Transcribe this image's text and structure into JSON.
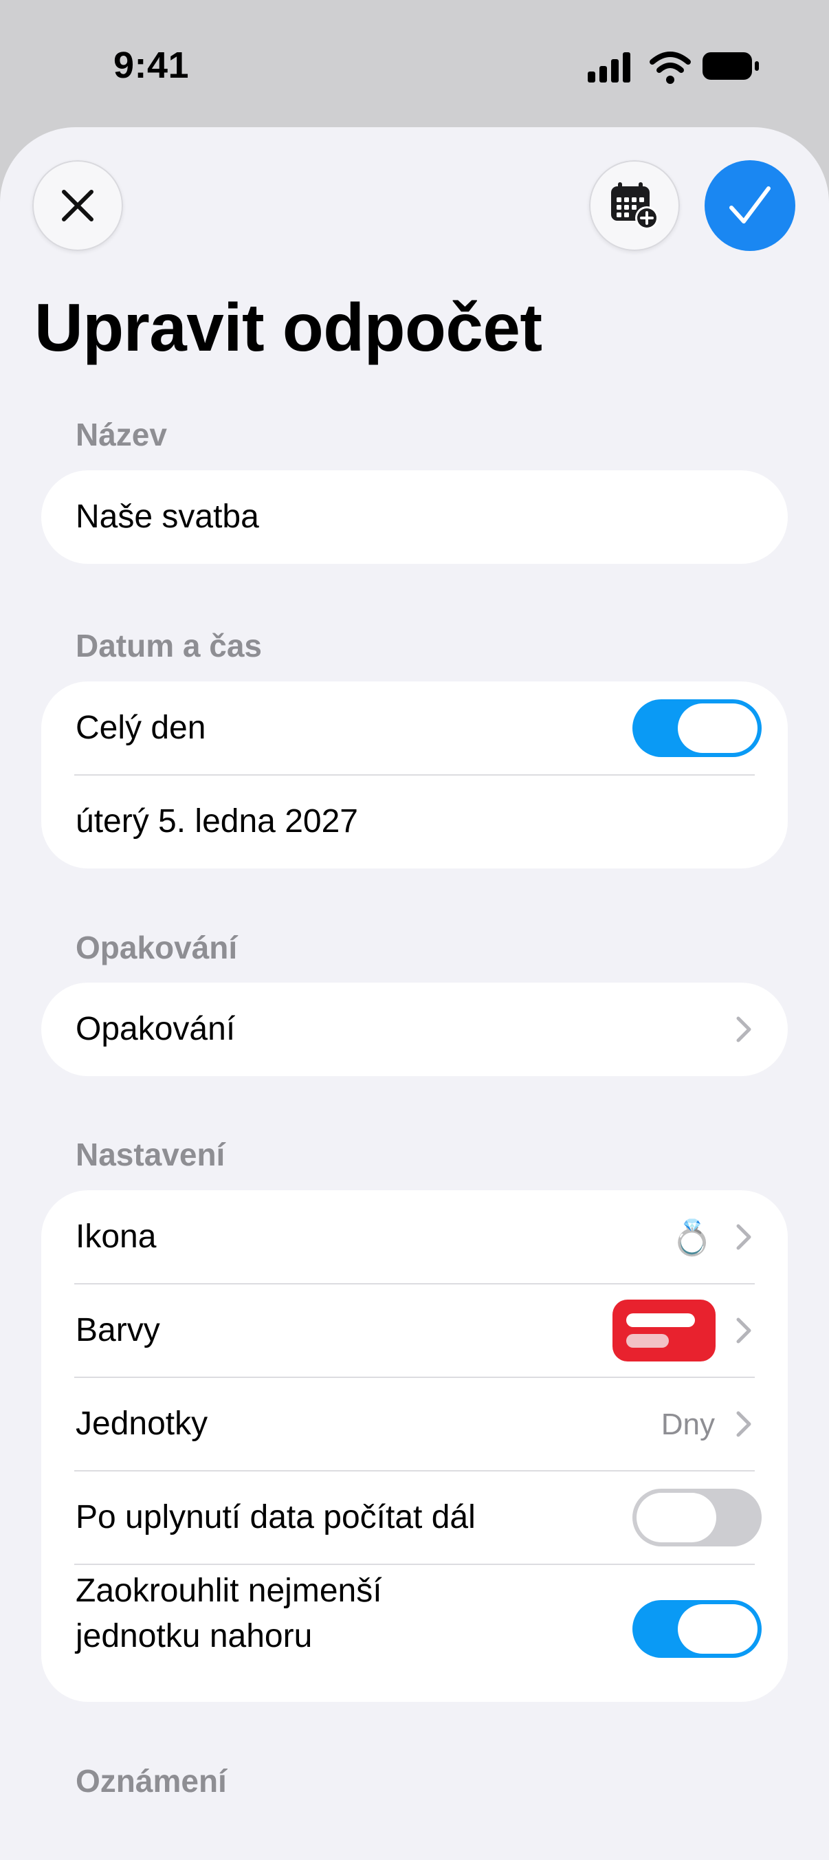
{
  "status": {
    "time": "9:41"
  },
  "header": {
    "title": "Upravit odpočet"
  },
  "colors": {
    "accent": "#1a87f2",
    "toggle_on": "#0a9af5",
    "chip": "#e8222e"
  },
  "sections": {
    "name": {
      "label": "Název",
      "value": "Naše svatba"
    },
    "datetime": {
      "label": "Datum a čas",
      "all_day_label": "Celý den",
      "all_day_on": true,
      "date": "úterý 5. ledna 2027"
    },
    "repeat": {
      "label": "Opakování",
      "row_label": "Opakování"
    },
    "settings": {
      "label": "Nastavení",
      "icon_label": "Ikona",
      "icon_value": "💍",
      "colors_label": "Barvy",
      "units_label": "Jednotky",
      "units_value": "Dny",
      "count_after_label": "Po uplynutí data počítat dál",
      "count_after_on": false,
      "round_up_line1": "Zaokrouhlit nejmenší",
      "round_up_line2": "jednotku nahoru",
      "round_up_on": true
    },
    "notifications": {
      "label": "Oznámení"
    }
  },
  "icons": [
    "close-icon",
    "calendar-add-icon",
    "checkmark-icon",
    "chevron-right-icon",
    "ring-icon",
    "signal-icon",
    "wifi-icon",
    "battery-icon"
  ]
}
